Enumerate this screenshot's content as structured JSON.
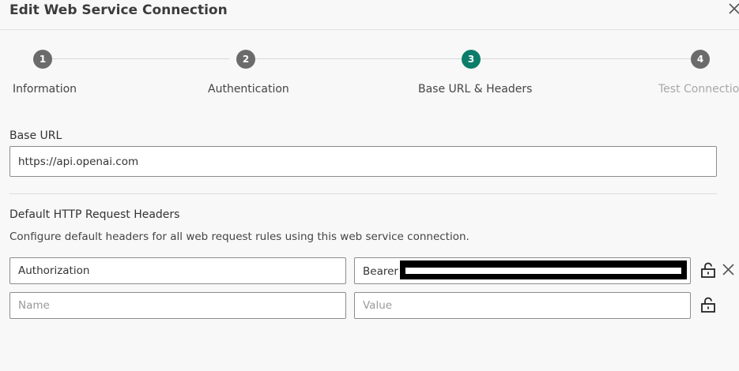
{
  "dialog": {
    "title": "Edit Web Service Connection",
    "close_icon": "close-icon"
  },
  "stepper": {
    "steps": [
      {
        "number": "1",
        "label": "Information",
        "state": "done"
      },
      {
        "number": "2",
        "label": "Authentication",
        "state": "done"
      },
      {
        "number": "3",
        "label": "Base URL & Headers",
        "state": "active"
      },
      {
        "number": "4",
        "label": "Test Connection",
        "state": "upcoming"
      }
    ]
  },
  "base_url": {
    "label": "Base URL",
    "value": "https://api.openai.com"
  },
  "headers": {
    "title": "Default HTTP Request Headers",
    "description": "Configure default headers for all web request rules using this web service connection.",
    "rows": [
      {
        "name": "Authorization",
        "value": "Bearer",
        "value_redacted": true,
        "lock_icon": "unlock-icon",
        "remove_icon": "close-icon"
      },
      {
        "name": "",
        "value": "",
        "lock_icon": "unlock-icon"
      }
    ],
    "name_placeholder": "Name",
    "value_placeholder": "Value"
  },
  "colors": {
    "active_step": "#0c7d6a",
    "step": "#6b6b6b",
    "muted_label": "#a8a8a8"
  }
}
